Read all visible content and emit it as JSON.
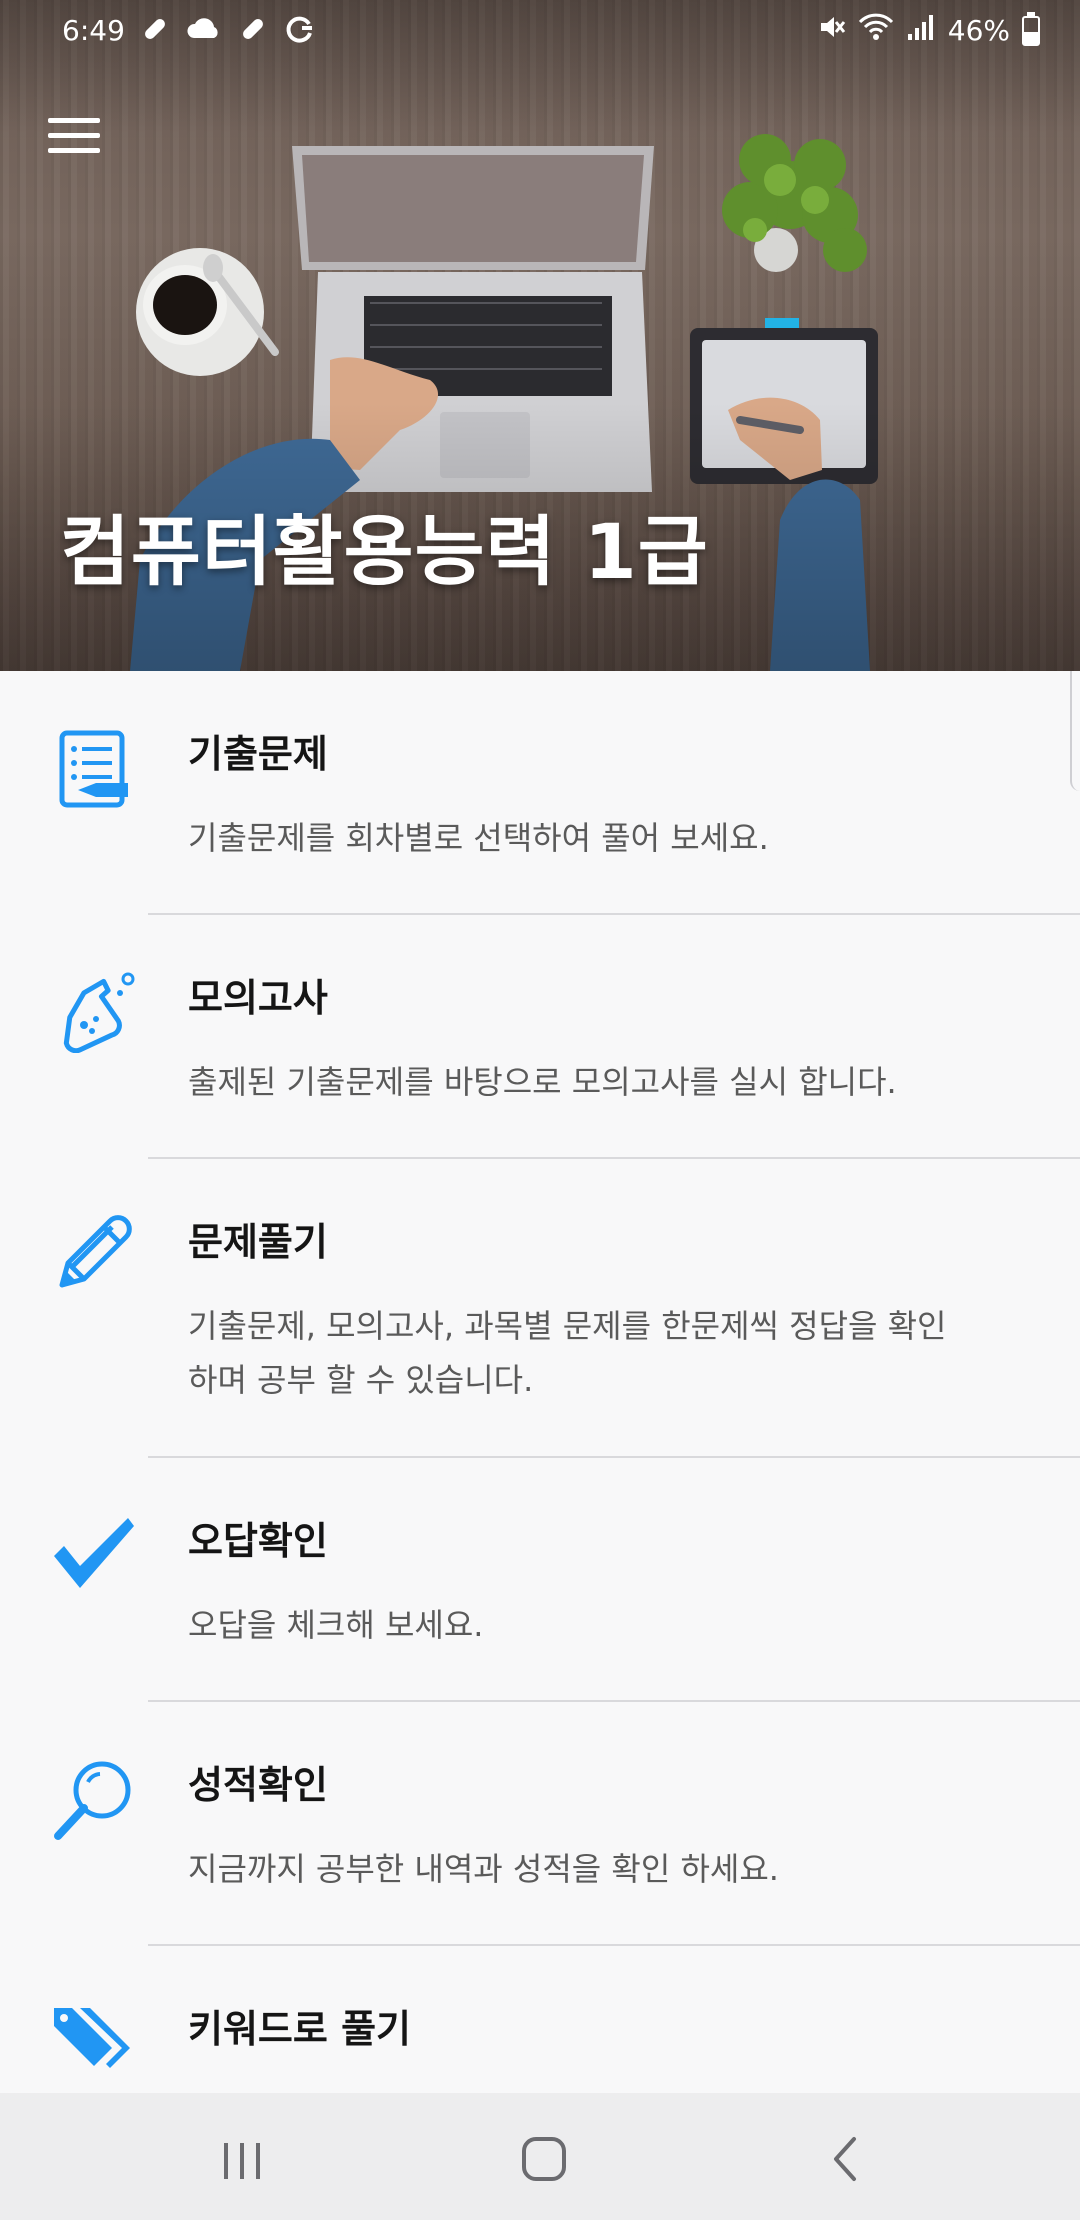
{
  "status_bar": {
    "time": "6:49",
    "battery_text": "46%",
    "battery_level": 0.46,
    "left_icons": [
      "bandage-icon",
      "cloud-icon",
      "bandage-icon",
      "sync-icon"
    ],
    "right_icons": [
      "mute-icon",
      "wifi-icon",
      "signal-icon",
      "battery-icon"
    ]
  },
  "header": {
    "title": "컴퓨터활용능력 1급",
    "menu_icon": "hamburger-menu-icon"
  },
  "menu": {
    "items": [
      {
        "title": "기출문제",
        "description": "기출문제를 회차별로 선택하여 풀어 보세요.",
        "icon": "document-list-icon"
      },
      {
        "title": "모의고사",
        "description": "출제된 기출문제를 바탕으로 모의고사를 실시 합니다.",
        "icon": "flask-icon"
      },
      {
        "title": "문제풀기",
        "description": "기출문제, 모의고사, 과목별 문제를 한문제씩 정답을 확인하며 공부 할 수 있습니다.",
        "icon": "pencil-icon"
      },
      {
        "title": "오답확인",
        "description": "오답을 체크해 보세요.",
        "icon": "checkmark-icon"
      },
      {
        "title": "성적확인",
        "description": "지금까지 공부한 내역과 성적을 확인 하세요.",
        "icon": "magnifier-icon"
      },
      {
        "title": "키워드로 풀기",
        "description": "",
        "icon": "tags-icon"
      }
    ]
  },
  "nav_bar": {
    "buttons": [
      "recent-apps-icon",
      "home-icon",
      "back-icon"
    ]
  },
  "colors": {
    "accent": "#2196f3",
    "title_text": "#151515",
    "desc_text": "#5a5a5a",
    "divider": "#d9d9dc",
    "nav_bg": "#ededee"
  }
}
